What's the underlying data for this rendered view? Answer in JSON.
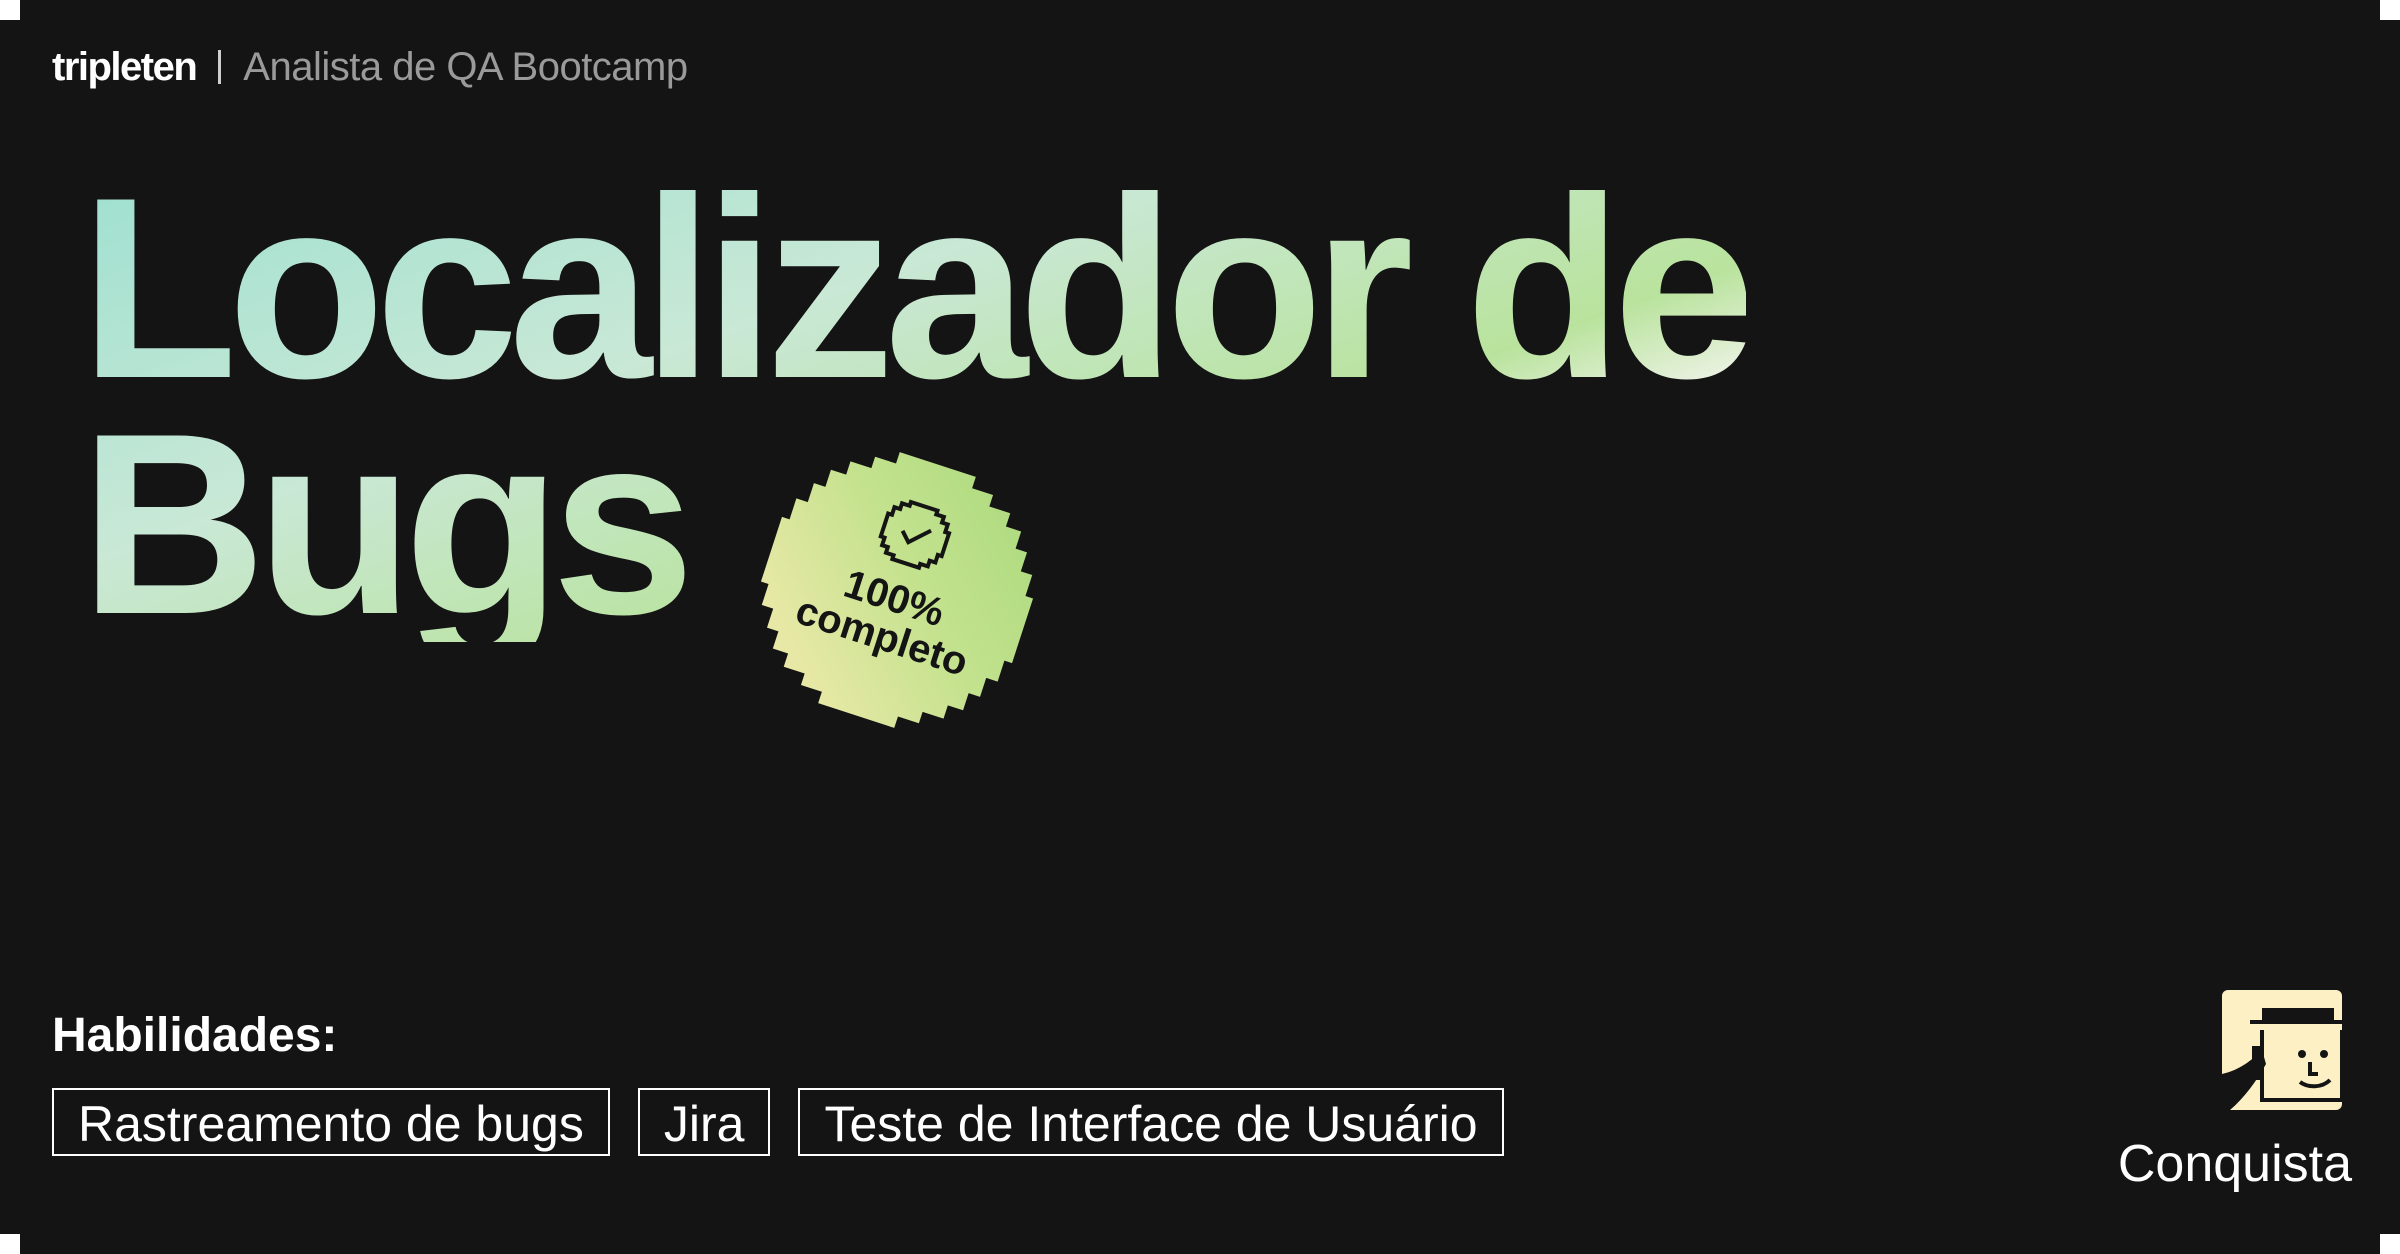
{
  "header": {
    "brand": "tripleten",
    "program": "Analista de QA Bootcamp"
  },
  "title": {
    "line1": "Localizador de",
    "line2": "Bugs"
  },
  "badge": {
    "line1": "100%",
    "line2": "completo",
    "icon": "check-badge-icon"
  },
  "skills": {
    "label": "Habilidades:",
    "items": [
      "Rastreamento de bugs",
      "Jira",
      "Teste de Interface de Usuário"
    ]
  },
  "achievement": {
    "label": "Conquista",
    "icon": "detective-avatar-icon"
  },
  "colors": {
    "background": "#141414",
    "title_gradient": [
      "#9ee0d0",
      "#b9e39d",
      "#f4efe3"
    ],
    "badge_gradient": [
      "#b7df8c",
      "#f5e9a8"
    ],
    "avatar_bg": "#fdf0c4"
  }
}
